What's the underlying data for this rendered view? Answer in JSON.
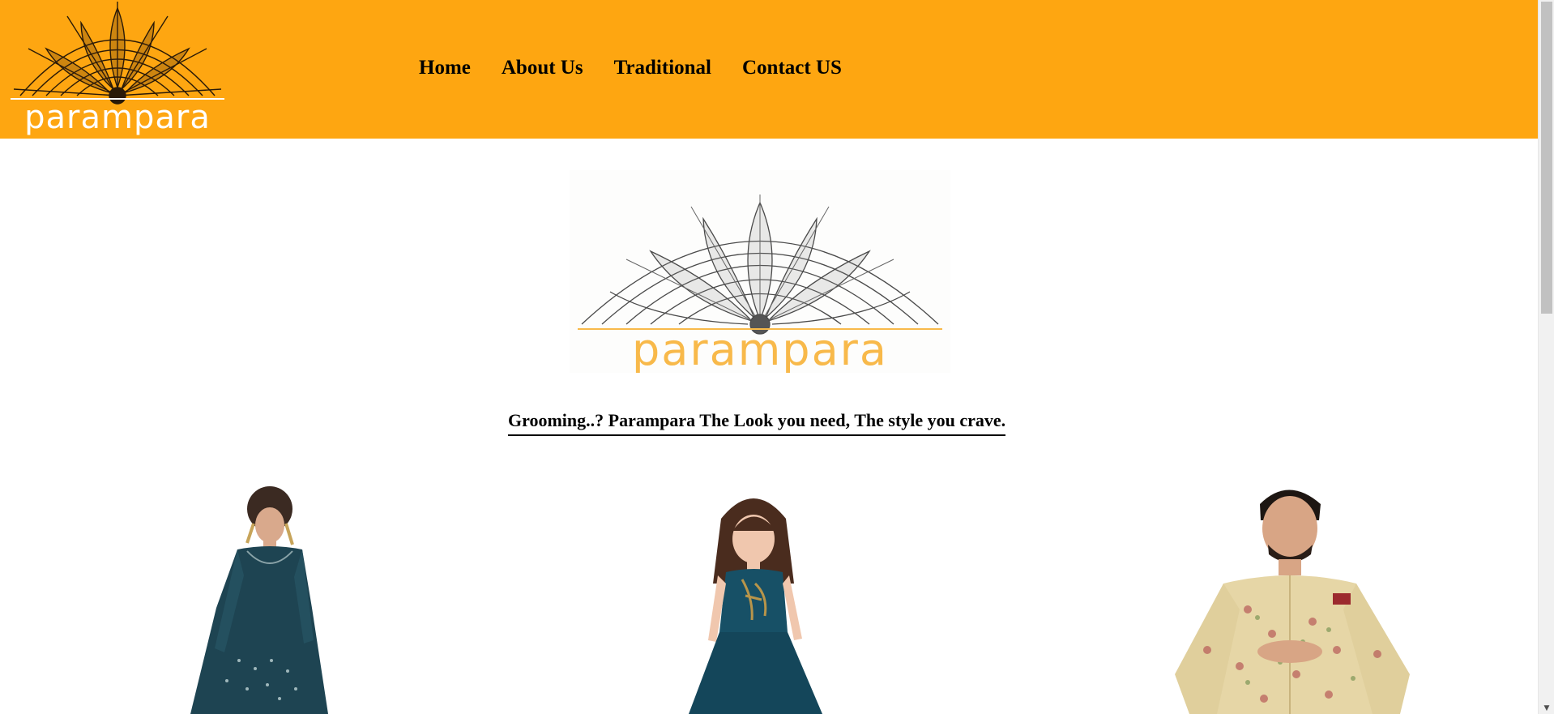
{
  "brand": {
    "name": "parampara",
    "header_logo_icon": "mandala-logo-icon",
    "hero_logo_icon": "mandala-logo-icon"
  },
  "nav": {
    "items": [
      {
        "label": "Home"
      },
      {
        "label": "About Us"
      },
      {
        "label": "Traditional"
      },
      {
        "label": "Contact US"
      }
    ]
  },
  "hero": {
    "tagline": "Grooming..? Parampara The Look you need, The style you crave."
  },
  "products": [
    {
      "image": "woman-anarkali-dress-image"
    },
    {
      "image": "girl-gown-image"
    },
    {
      "image": "man-sherwani-image"
    }
  ],
  "colors": {
    "header_bg": "#fea611",
    "brand_orange": "#f8b94a",
    "text": "#000000"
  }
}
